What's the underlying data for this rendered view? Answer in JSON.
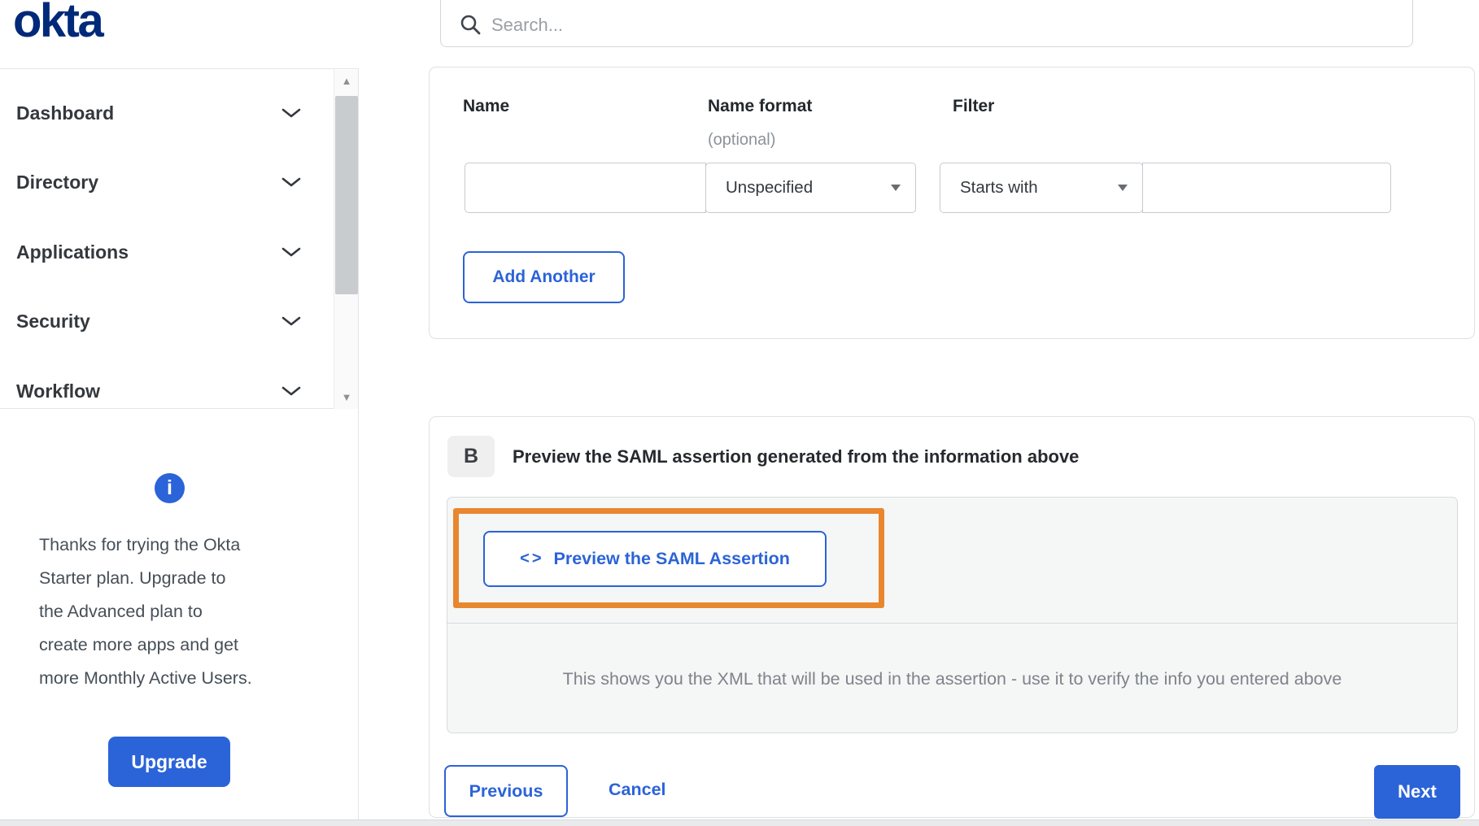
{
  "brand": {
    "logo": "okta"
  },
  "topbar": {
    "search_placeholder": "Search..."
  },
  "sidebar": {
    "items": [
      {
        "label": "Dashboard"
      },
      {
        "label": "Directory"
      },
      {
        "label": "Applications"
      },
      {
        "label": "Security"
      },
      {
        "label": "Workflow"
      }
    ],
    "promo": {
      "info_icon": "i",
      "lines": [
        "Thanks for trying the Okta",
        "Starter plan. Upgrade to",
        "the Advanced plan to",
        "create more apps and get",
        "more Monthly Active Users."
      ],
      "upgrade_label": "Upgrade"
    }
  },
  "attribute_statements": {
    "columns": {
      "name": "Name",
      "name_format": "Name format",
      "name_format_note": "(optional)",
      "filter": "Filter"
    },
    "fields": {
      "name_value": "",
      "name_format_selected": "Unspecified",
      "filter_operator_selected": "Starts with",
      "filter_value": ""
    },
    "add_another_label": "Add Another"
  },
  "preview_section": {
    "badge": "B",
    "heading": "Preview the SAML assertion generated from the information above",
    "preview_button": {
      "icon": "<>",
      "label": "Preview the SAML Assertion"
    },
    "help_text": "This shows you the XML that will be used in the assertion - use it to verify the info you entered above"
  },
  "footer": {
    "previous_label": "Previous",
    "cancel_label": "Cancel",
    "next_label": "Next"
  },
  "colors": {
    "accent_blue": "#2b63d8",
    "logo_navy": "#00297a",
    "annotation_orange": "#e8872e"
  }
}
